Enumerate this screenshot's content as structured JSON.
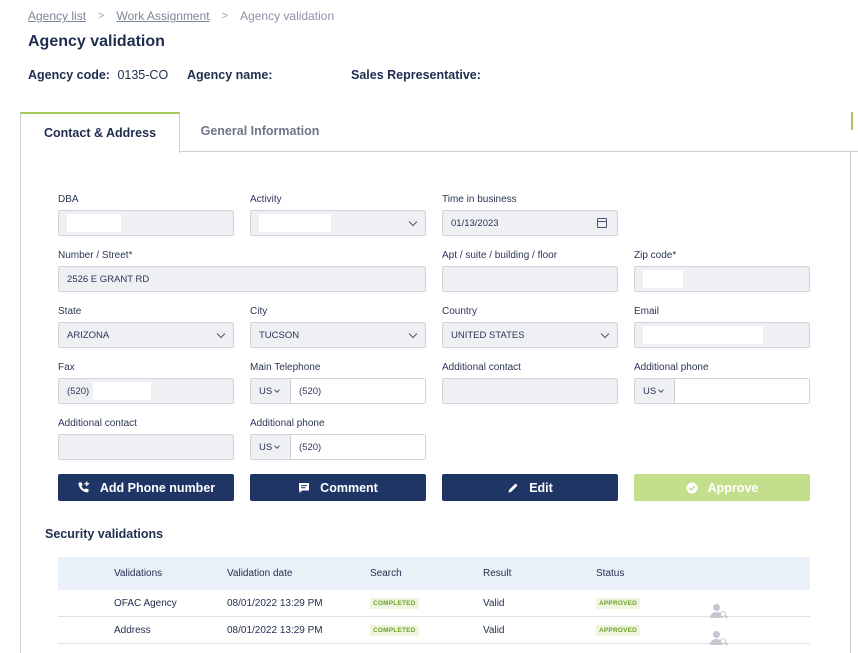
{
  "breadcrumb": {
    "items": [
      "Agency list",
      "Work Assignment"
    ],
    "current": "Agency validation",
    "separator": ">"
  },
  "page": {
    "title": "Agency validation"
  },
  "agency": {
    "code_label": "Agency code:",
    "code_value": "0135-CO",
    "name_label": "Agency name:",
    "name_value": "",
    "sales_label": "Sales Representative:",
    "sales_value": ""
  },
  "tabs": {
    "active": "Contact & Address",
    "inactive": "General Information"
  },
  "form": {
    "dba": {
      "label": "DBA",
      "value": ""
    },
    "activity": {
      "label": "Activity",
      "value": ""
    },
    "time_in_business": {
      "label": "Time in business",
      "value": "01/13/2023"
    },
    "street": {
      "label": "Number / Street*",
      "value": "2526 E GRANT RD"
    },
    "apt": {
      "label": "Apt / suite / building / floor",
      "value": ""
    },
    "zip": {
      "label": "Zip code*",
      "value": ""
    },
    "state": {
      "label": "State",
      "value": "ARIZONA"
    },
    "city": {
      "label": "City",
      "value": "TUCSON"
    },
    "country": {
      "label": "Country",
      "value": "UNITED STATES"
    },
    "email": {
      "label": "Email",
      "value": ""
    },
    "fax": {
      "label": "Fax",
      "value": "(520)"
    },
    "main_phone": {
      "label": "Main Telephone",
      "cc": "US",
      "value": "(520)"
    },
    "add_contact_1": {
      "label": "Additional contact",
      "value": ""
    },
    "add_phone_1": {
      "label": "Additional phone",
      "cc": "US",
      "value": ""
    },
    "add_contact_2": {
      "label": "Additional contact",
      "value": ""
    },
    "add_phone_2": {
      "label": "Additional phone",
      "cc": "US",
      "value": "(520)"
    }
  },
  "buttons": {
    "add_phone": "Add Phone number",
    "comment": "Comment",
    "edit": "Edit",
    "approve": "Approve"
  },
  "security": {
    "title": "Security validations",
    "headers": [
      "Validations",
      "Validation date",
      "Search",
      "Result",
      "Status"
    ],
    "rows": [
      {
        "validation": "OFAC Agency",
        "date": "08/01/2022 13:29 PM",
        "search": "COMPLETED",
        "result": "Valid",
        "status": "APPROVED"
      },
      {
        "validation": "Address",
        "date": "08/01/2022 13:29 PM",
        "search": "COMPLETED",
        "result": "Valid",
        "status": "APPROVED"
      }
    ]
  },
  "colors": {
    "primary": "#1f3566",
    "accent": "#a4c85a",
    "approve_disabled": "#c4df8b",
    "badge_green": "#6ea12a"
  }
}
